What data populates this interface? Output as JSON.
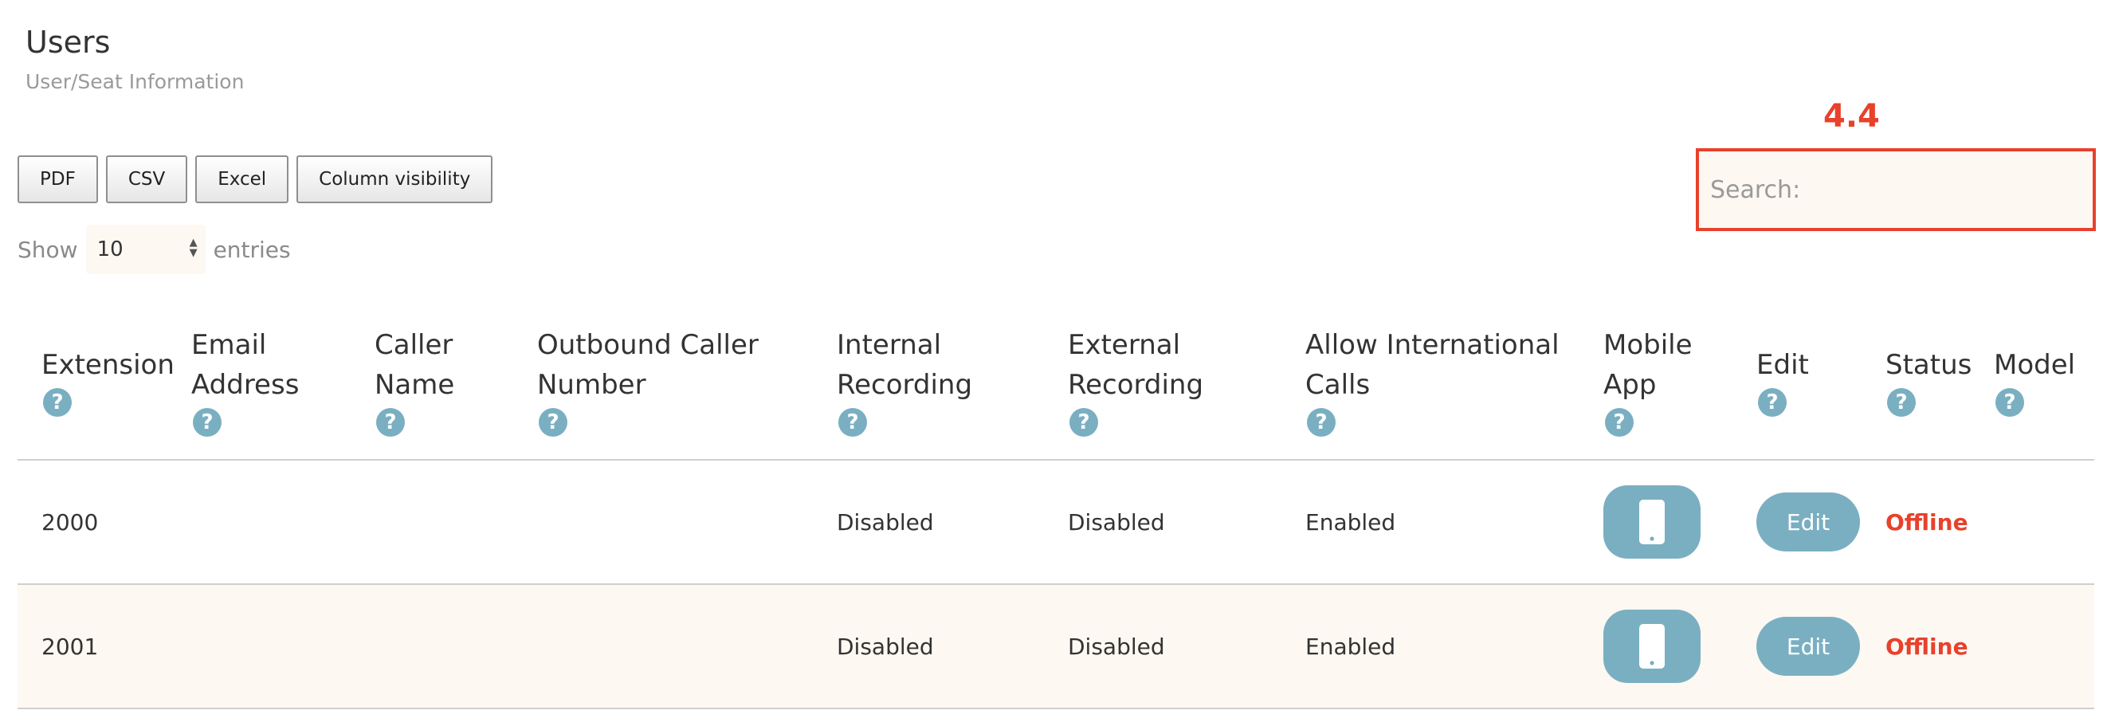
{
  "page": {
    "title": "Users",
    "subtitle": "User/Seat Information"
  },
  "annotation": {
    "label": "4.4",
    "color": "#e8412c"
  },
  "toolbar": {
    "buttons": [
      "PDF",
      "CSV",
      "Excel",
      "Column visibility"
    ]
  },
  "length": {
    "show_label": "Show",
    "value": "10",
    "entries_label": "entries"
  },
  "search": {
    "label": "Search:",
    "value": ""
  },
  "table": {
    "headers": [
      "Extension",
      "Email\nAddress",
      "Caller\nName",
      "Outbound Caller\nNumber",
      "Internal\nRecording",
      "External\nRecording",
      "Allow International\nCalls",
      "Mobile\nApp",
      "Edit",
      "Status",
      "Model"
    ],
    "help_icon": "question-circle-icon",
    "rows": [
      {
        "extension": "2000",
        "email": "",
        "caller_name": "",
        "outbound_number": "",
        "internal_recording": "Disabled",
        "external_recording": "Disabled",
        "international_calls": "Enabled",
        "mobile_app_icon": "mobile-phone-icon",
        "edit_label": "Edit",
        "status": "Offline",
        "model": ""
      },
      {
        "extension": "2001",
        "email": "",
        "caller_name": "",
        "outbound_number": "",
        "internal_recording": "Disabled",
        "external_recording": "Disabled",
        "international_calls": "Enabled",
        "mobile_app_icon": "mobile-phone-icon",
        "edit_label": "Edit",
        "status": "Offline",
        "model": ""
      }
    ]
  },
  "colors": {
    "accent": "#7aafc2",
    "offline": "#e8412c",
    "row_alt": "#fdf8f2"
  }
}
